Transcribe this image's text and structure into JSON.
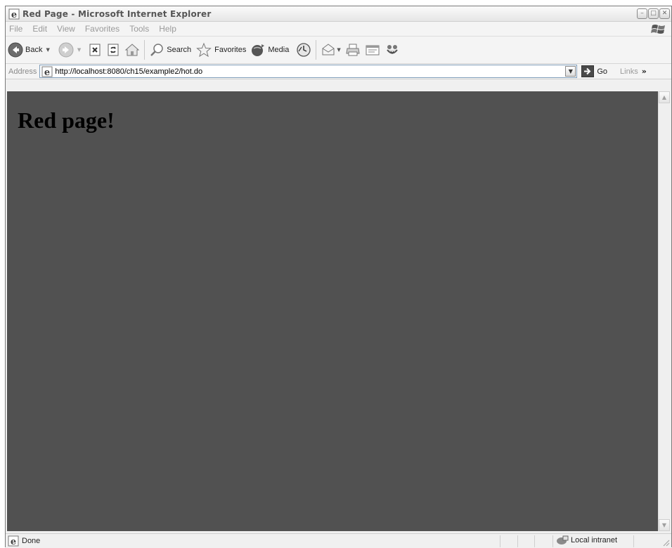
{
  "window": {
    "title": "Red Page - Microsoft Internet Explorer"
  },
  "menu": {
    "items": [
      "File",
      "Edit",
      "View",
      "Favorites",
      "Tools",
      "Help"
    ]
  },
  "toolbar": {
    "back_label": "Back",
    "search_label": "Search",
    "favorites_label": "Favorites",
    "media_label": "Media"
  },
  "address": {
    "label": "Address",
    "url": "http://localhost:8080/ch15/example2/hot.do",
    "go_label": "Go",
    "links_label": "Links"
  },
  "page": {
    "heading": "Red page!",
    "background_color": "#515151"
  },
  "status": {
    "text": "Done",
    "zone": "Local intranet"
  },
  "icons": [
    "ie-icon",
    "back-icon",
    "forward-icon",
    "stop-icon",
    "refresh-icon",
    "home-icon",
    "search-icon",
    "favorites-icon",
    "media-icon",
    "history-icon",
    "mail-icon",
    "print-icon",
    "edit-icon",
    "messenger-icon",
    "go-icon",
    "local-intranet-icon"
  ]
}
